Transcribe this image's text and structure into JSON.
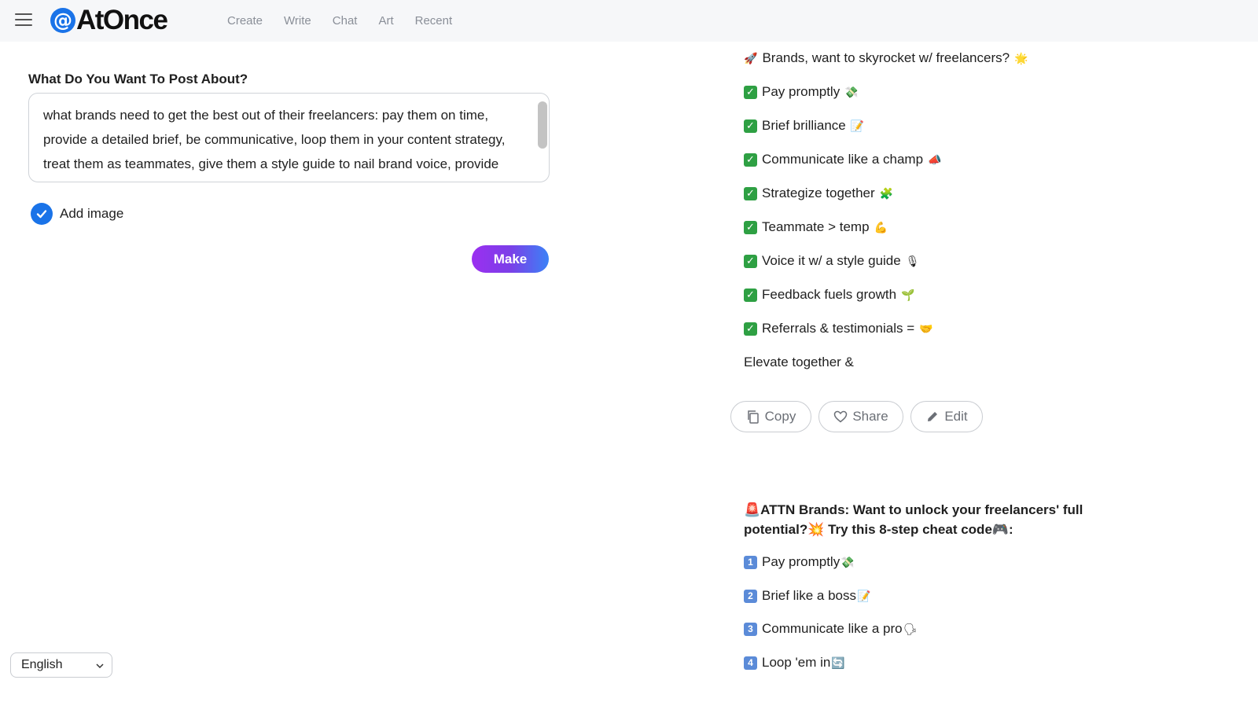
{
  "app": {
    "logo_at": "@",
    "logo_text": "AtOnce"
  },
  "nav": {
    "items": [
      "Create",
      "Write",
      "Chat",
      "Art",
      "Recent"
    ]
  },
  "form": {
    "label": "What Do You Want To Post About?",
    "textarea_value": "what brands need to get the best out of their freelancers: pay them on time, provide a detailed brief, be communicative, loop them in your content strategy, treat them as teammates, give them a style guide to nail brand voice, provide regular feedback for them to improve, help their business with",
    "add_image_label": "Add image",
    "add_image_checked": true,
    "make_button": "Make"
  },
  "language": {
    "selected": "English"
  },
  "post1": {
    "headline": "Brands, want to skyrocket w/ freelancers?",
    "headline_emoji_left": "🚀",
    "headline_emoji_right": "🌟",
    "items": [
      {
        "text": "Pay promptly",
        "emoji": "💸"
      },
      {
        "text": "Brief brilliance",
        "emoji": "📝"
      },
      {
        "text": "Communicate like a champ",
        "emoji": "📣"
      },
      {
        "text": "Strategize together",
        "emoji": "🧩"
      },
      {
        "text": "Teammate > temp",
        "emoji": "💪"
      },
      {
        "text": "Voice it w/ a style guide",
        "emoji": "🎙"
      },
      {
        "text": "Feedback fuels growth",
        "emoji": "🌱"
      },
      {
        "text": "Referrals & testimonials =",
        "emoji": "🤝"
      }
    ],
    "closing": "Elevate together &"
  },
  "actions": {
    "copy": "Copy",
    "share": "Share",
    "edit": "Edit"
  },
  "post2": {
    "headline": "🚨ATTN Brands: Want to unlock your freelancers' full potential?💥 Try this 8-step cheat code🎮:",
    "items": [
      {
        "num": "1",
        "text": "Pay promptly",
        "emoji": "💸"
      },
      {
        "num": "2",
        "text": "Brief like a boss",
        "emoji": "📝"
      },
      {
        "num": "3",
        "text": "Communicate like a pro",
        "emoji": "🗣"
      },
      {
        "num": "4",
        "text": "Loop 'em in",
        "emoji": "🔄"
      }
    ]
  }
}
